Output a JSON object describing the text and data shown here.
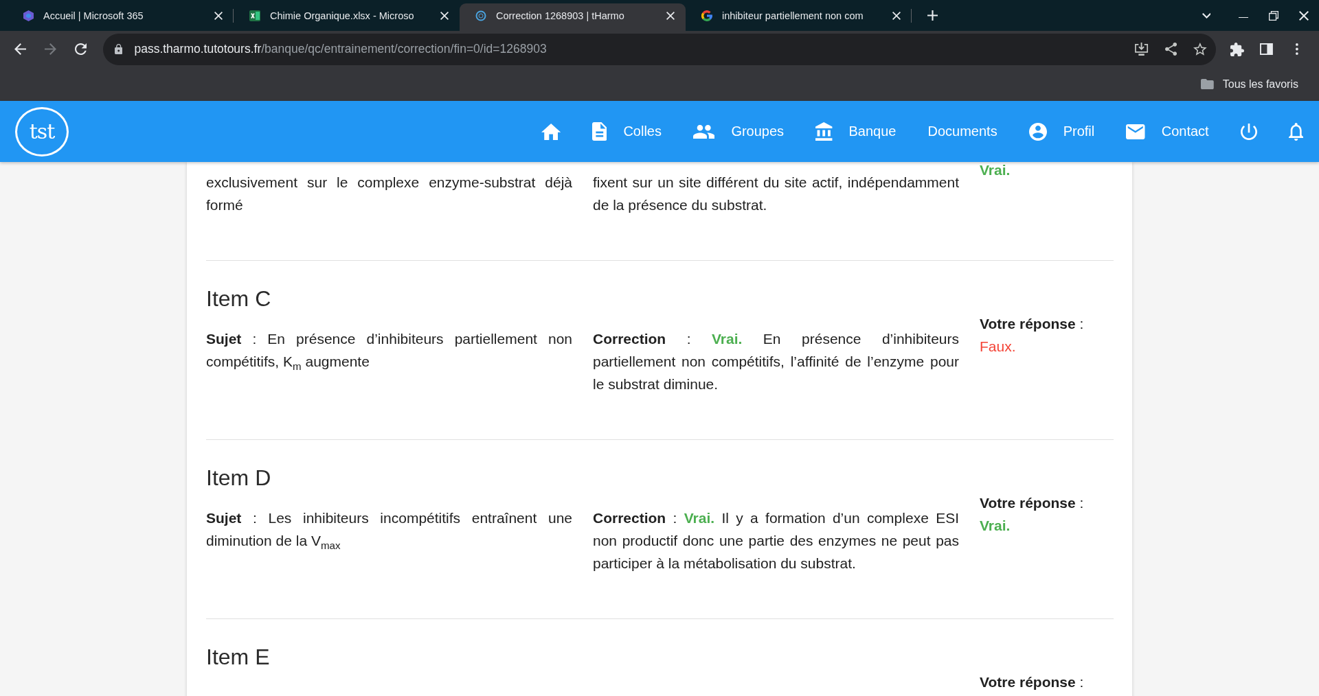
{
  "browser": {
    "tabs": [
      {
        "kind": "m365",
        "title": "Accueil | Microsoft 365",
        "selected": false
      },
      {
        "kind": "excel",
        "title": "Chimie Organique.xlsx - Microso",
        "selected": false
      },
      {
        "kind": "tharmo",
        "title": "Correction 1268903 | tHarmo",
        "selected": true
      },
      {
        "kind": "google",
        "title": "inhibiteur partiellement non com",
        "selected": false
      }
    ],
    "nav_buttons": [
      {
        "kind": "back",
        "disabled": false
      },
      {
        "kind": "forward",
        "disabled": true
      },
      {
        "kind": "reload",
        "disabled": false
      }
    ],
    "address_bar": {
      "host": "pass.tharmo.tutotours.fr",
      "path": "/banque/qc/entrainement/correction/fin=0/id=1268903"
    },
    "bookmarks": [
      {
        "label": "Tous les favoris"
      }
    ]
  },
  "navbar": {
    "logo_text": "tst",
    "items": [
      {
        "kind": "home"
      },
      {
        "kind": "document",
        "label": "Colles"
      },
      {
        "kind": "group",
        "label": "Groupes"
      },
      {
        "kind": "bank",
        "label": "Banque"
      },
      {
        "label": "Documents"
      },
      {
        "kind": "account",
        "label": "Profil"
      },
      {
        "kind": "mail",
        "label": "Contact"
      },
      {
        "kind": "power"
      },
      {
        "kind": "bell"
      }
    ]
  },
  "items": [
    {
      "subject": {
        "text": "exclusivement sur le complexe enzyme-substrat déjà formé"
      },
      "correction": {
        "text": "fixent sur un site différent du site actif, indépendamment de la présence du substrat."
      },
      "answer": {
        "value": "Vrai.",
        "value_true": true
      }
    },
    {
      "title": "Item C",
      "subject": {
        "text": "**Sujet** : En présence d’inhibiteurs partiellement non compétitifs, K$_{m}$ augmente"
      },
      "correction": {
        "lead": "**Correction** :",
        "verdict": "Vrai.",
        "verdict_true": true,
        "text": "En présence d’inhibiteurs partiellement non compétitifs, l’affinité de l’enzyme pour le substrat diminue."
      },
      "answer": {
        "label": "**Votre réponse** :",
        "value": "Faux.",
        "value_true": false
      }
    },
    {
      "title": "Item D",
      "subject": {
        "text": "**Sujet** : Les inhibiteurs incompétitifs entraînent une diminution de la V$_{max}$"
      },
      "correction": {
        "lead": "**Correction** :",
        "verdict": "Vrai.",
        "verdict_true": true,
        "text": "Il y a formation d’un complexe ESI non productif donc une partie des enzymes ne peut pas participer à la métabolisation du substrat."
      },
      "answer": {
        "label": "**Votre réponse** :",
        "value": "Vrai.",
        "value_true": true
      }
    },
    {
      "title": "Item E",
      "answer": {
        "label": "**Votre réponse** :"
      }
    }
  ]
}
